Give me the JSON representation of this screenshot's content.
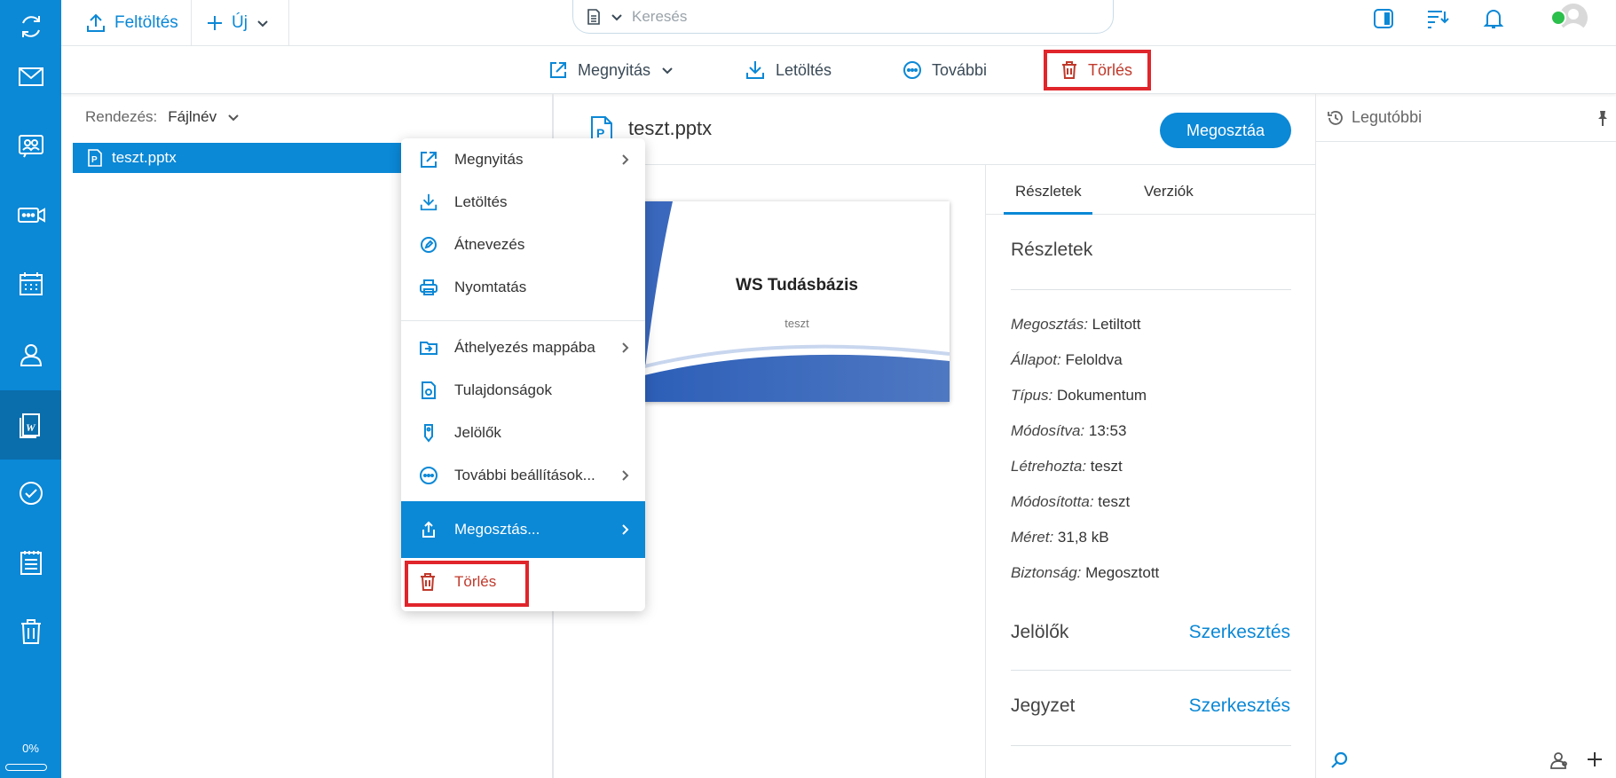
{
  "rail": {
    "quota_label": "0%"
  },
  "topbar": {
    "upload_label": "Feltöltés",
    "new_label": "Új",
    "search_placeholder": "Keresés"
  },
  "actionbar": {
    "open_label": "Megnyitás",
    "download_label": "Letöltés",
    "more_label": "További",
    "delete_label": "Törlés"
  },
  "list": {
    "sort_label": "Rendezés:",
    "sort_value": "Fájlnév",
    "file_name": "teszt.pptx"
  },
  "context_menu": {
    "items": [
      {
        "label": "Megnyitás",
        "icon": "external-link-icon"
      },
      {
        "label": "Letöltés",
        "icon": "download-icon"
      },
      {
        "label": "Átnevezés",
        "icon": "pencil-icon"
      },
      {
        "label": "Nyomtatás",
        "icon": "printer-icon"
      },
      {
        "label": "Áthelyezés mappába",
        "icon": "move-folder-icon"
      },
      {
        "label": "Tulajdonságok",
        "icon": "properties-icon"
      },
      {
        "label": "Jelölők",
        "icon": "tag-icon"
      },
      {
        "label": "További beállítások...",
        "icon": "more-icon"
      },
      {
        "label": "Megosztás...",
        "icon": "share-icon"
      },
      {
        "label": "Törlés",
        "icon": "trash-icon"
      }
    ]
  },
  "preview": {
    "file_title": "teszt.pptx",
    "share_button": "Megosztáa",
    "slide_title": "WS Tudásbázis",
    "slide_subtitle": "teszt"
  },
  "details": {
    "tabs": [
      "Részletek",
      "Verziók"
    ],
    "section_title": "Részletek",
    "props": [
      {
        "key": "Megosztás:",
        "value": "Letiltott"
      },
      {
        "key": "Állapot:",
        "value": "Feloldva"
      },
      {
        "key": "Típus:",
        "value": "Dokumentum"
      },
      {
        "key": "Módosítva:",
        "value": "13:53"
      },
      {
        "key": "Létrehozta:",
        "value": "teszt"
      },
      {
        "key": "Módosította:",
        "value": "teszt"
      },
      {
        "key": "Méret:",
        "value": "31,8 kB"
      },
      {
        "key": "Biztonság:",
        "value": "Megosztott"
      }
    ],
    "tags_title": "Jelölők",
    "tags_edit": "Szerkesztés",
    "note_title": "Jegyzet",
    "note_edit": "Szerkesztés"
  },
  "right_pane": {
    "recent_label": "Legutóbbi"
  },
  "colors": {
    "accent": "#0b88d6",
    "danger": "#c0392b",
    "highlight_frame": "#e0252b"
  }
}
